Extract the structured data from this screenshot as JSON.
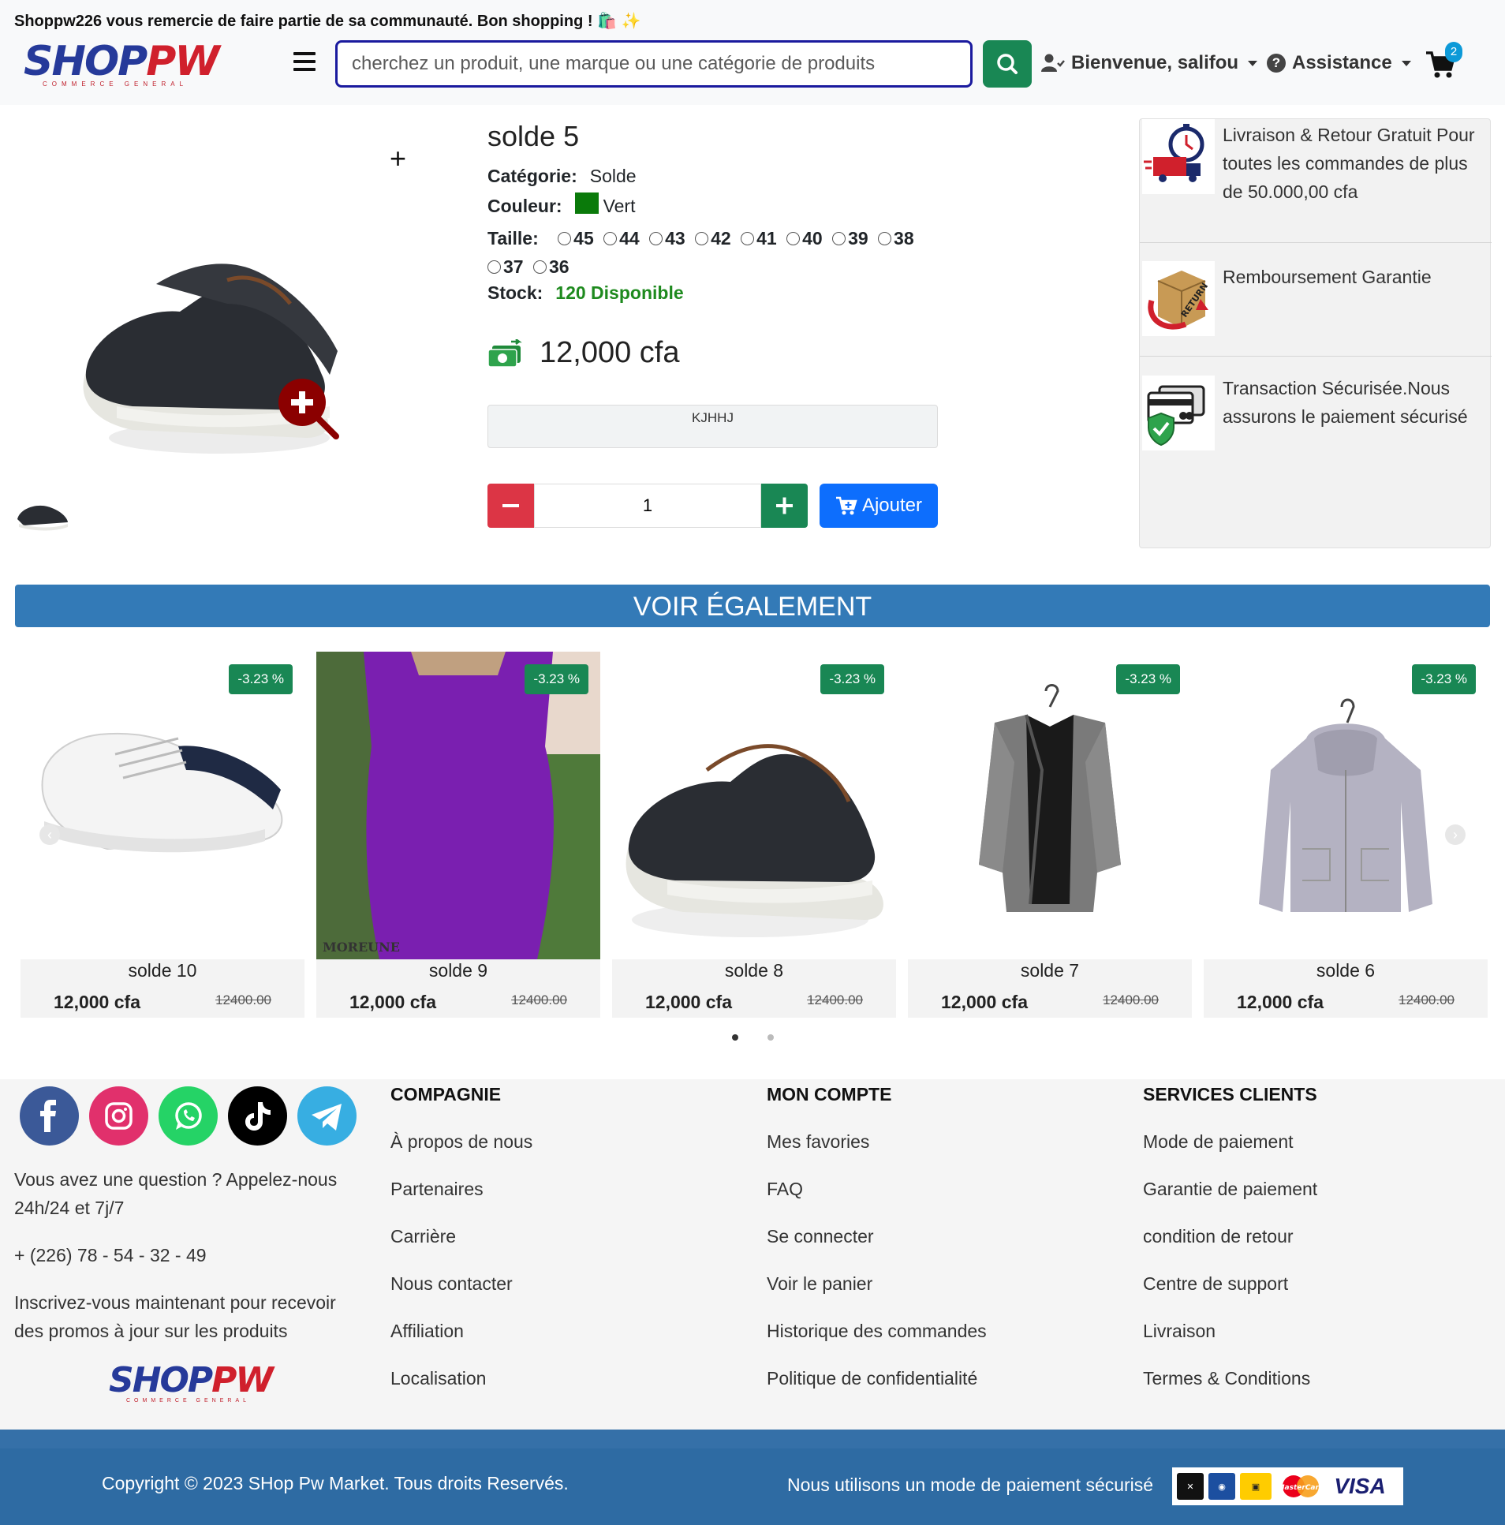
{
  "header": {
    "announcement": "Shoppw226 vous remercie de faire partie de sa communauté. Bon shopping ! 🛍️ ✨",
    "logo": {
      "brand_main": "SHOP",
      "brand_accent": "PW",
      "tagline": "COMMERCE GENERAL"
    },
    "search_placeholder": "cherchez un produit, une marque ou une catégorie de produits",
    "welcome": "Bienvenue, salifou",
    "assistance": "Assistance",
    "cart_count": "2",
    "icons": [
      "menu-icon",
      "search-icon",
      "user-check-icon",
      "question-circle-icon",
      "cart-icon"
    ]
  },
  "product": {
    "title": "solde 5",
    "category_label": "Catégorie:",
    "category": "Solde",
    "color_label": "Couleur:",
    "color": "Vert",
    "color_hex": "#0a7a0a",
    "size_label": "Taille:",
    "sizes": [
      "45",
      "44",
      "43",
      "42",
      "41",
      "40",
      "39",
      "38",
      "37",
      "36"
    ],
    "stock_label": "Stock:",
    "stock": "120 Disponible",
    "price": "12,000 cfa",
    "description": "KJHHJ",
    "quantity": "1",
    "add_label": "Ajouter"
  },
  "perks": [
    {
      "text": "Livraison & Retour Gratuit Pour toutes les commandes de plus de 50.000,00 cfa",
      "icon": "fast-delivery-icon"
    },
    {
      "text": "Remboursement Garantie",
      "icon": "return-box-icon"
    },
    {
      "text": "Transaction Sécurisée.Nous assurons le paiement sécurisé",
      "icon": "secure-card-icon"
    }
  ],
  "see_also": {
    "title": "VOIR ÉGALEMENT",
    "items": [
      {
        "name": "solde 10",
        "price": "12,000 cfa",
        "old_price": "12400.00",
        "discount": "-3.23 %"
      },
      {
        "name": "solde 9",
        "price": "12,000 cfa",
        "old_price": "12400.00",
        "discount": "-3.23 %",
        "watermark": "MOREUNE"
      },
      {
        "name": "solde 8",
        "price": "12,000 cfa",
        "old_price": "12400.00",
        "discount": "-3.23 %"
      },
      {
        "name": "solde 7",
        "price": "12,000 cfa",
        "old_price": "12400.00",
        "discount": "-3.23 %"
      },
      {
        "name": "solde 6",
        "price": "12,000 cfa",
        "old_price": "12400.00",
        "discount": "-3.23 %"
      }
    ]
  },
  "footer": {
    "socials": [
      "facebook-icon",
      "instagram-icon",
      "whatsapp-icon",
      "tiktok-icon",
      "telegram-icon"
    ],
    "question": "Vous avez une question ? Appelez-nous 24h/24 et 7j/7",
    "phone": "+ (226) 78 - 54 - 32 - 49",
    "newsletter": "Inscrivez-vous maintenant pour recevoir des promos à jour sur les produits",
    "columns": [
      {
        "title": "COMPAGNIE",
        "links": [
          "À propos de nous",
          "Partenaires",
          "Carrière",
          "Nous contacter",
          "Affiliation",
          "Localisation"
        ]
      },
      {
        "title": "MON COMPTE",
        "links": [
          "Mes favories",
          "FAQ",
          "Se connecter",
          "Voir le panier",
          "Historique des commandes",
          "Politique de confidentialité"
        ]
      },
      {
        "title": "SERVICES CLIENTS",
        "links": [
          "Mode de paiement",
          "Garantie de paiement",
          "condition de retour",
          "Centre de support",
          "Livraison",
          "Termes & Conditions"
        ]
      }
    ],
    "copyright": "Copyright © 2023 SHop Pw Market. Tous droits Reservés.",
    "secure_payment": "Nous utilisons un mode de paiement sécurisé",
    "payment_methods": [
      "MasterCard",
      "VISA"
    ]
  }
}
